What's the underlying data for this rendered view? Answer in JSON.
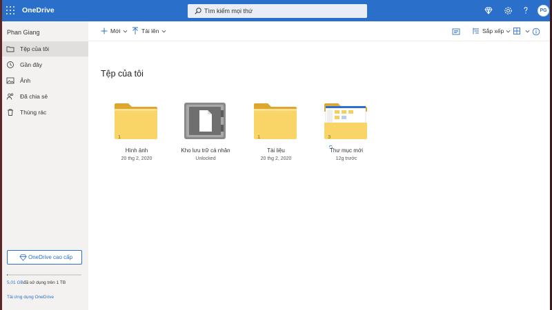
{
  "topbar": {
    "app_title": "OneDrive",
    "search_placeholder": "Tìm kiếm mọi thứ",
    "avatar_initials": "PG",
    "icons": [
      "app-launcher-icon",
      "premium-diamond-icon",
      "settings-gear-icon",
      "help-question-icon"
    ],
    "accent_color": "#2a6fc9"
  },
  "sidebar": {
    "user_name": "Phan Giang",
    "items": [
      {
        "label": "Tệp của tôi",
        "icon": "folder-icon",
        "active": true
      },
      {
        "label": "Gần đây",
        "icon": "clock-icon",
        "active": false
      },
      {
        "label": "Ảnh",
        "icon": "image-icon",
        "active": false
      },
      {
        "label": "Đã chia sẻ",
        "icon": "people-icon",
        "active": false
      },
      {
        "label": "Thùng rác",
        "icon": "trash-icon",
        "active": false
      }
    ],
    "premium_button": "OneDrive cao cấp",
    "storage": {
      "used_label": "5,01 GB",
      "rest_label": "đã sử dụng trên 1 TB",
      "used_fraction": 0.005
    },
    "apps_link": "Tải ứng dụng OneDrive"
  },
  "commandbar": {
    "new_label": "Mới",
    "upload_label": "Tải lên",
    "sort_label": "Sắp xếp"
  },
  "main": {
    "title": "Tệp của tôi",
    "tiles": [
      {
        "name": "Hình ảnh",
        "sub": "20 thg 2, 2020",
        "count": "1",
        "kind": "folder"
      },
      {
        "name": "Kho lưu trữ cá nhân",
        "sub": "Unlocked",
        "count": "",
        "kind": "vault"
      },
      {
        "name": "Tài liệu",
        "sub": "20 thg 2, 2020",
        "count": "1",
        "kind": "folder"
      },
      {
        "name": "Thư mục mới",
        "sub": "12g trước",
        "count": "3",
        "kind": "folder-preview"
      }
    ]
  }
}
